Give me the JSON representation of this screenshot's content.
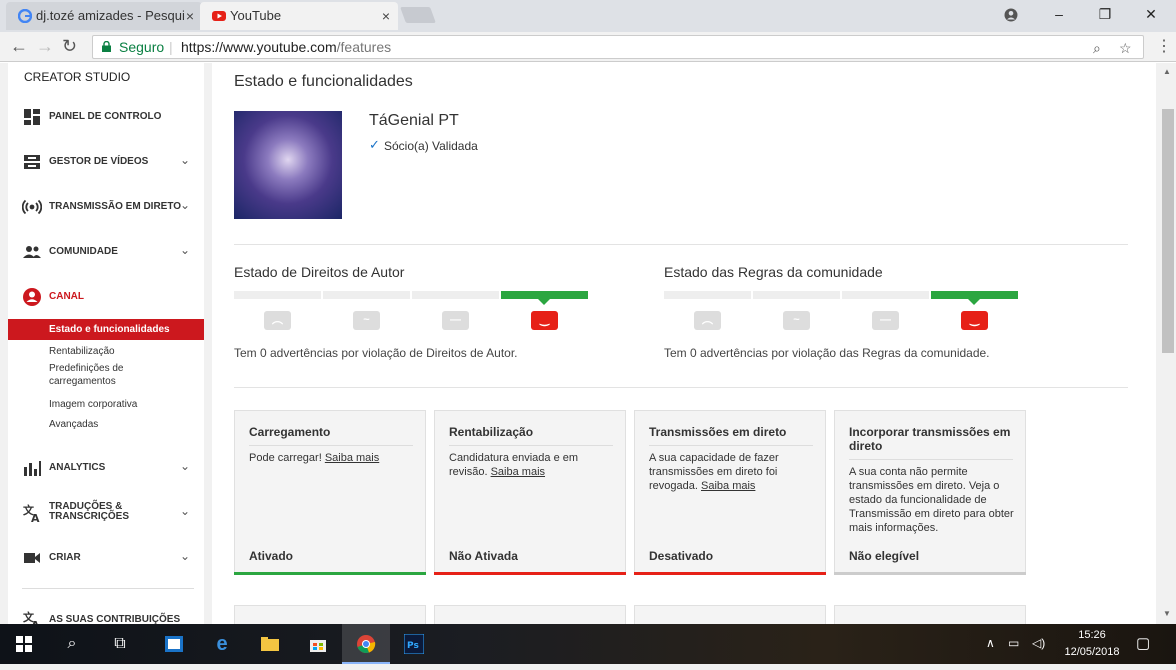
{
  "browser": {
    "tabs": [
      {
        "label": "dj.tozé amizades - Pesqui",
        "close": "×"
      },
      {
        "label": "YouTube",
        "close": "×"
      }
    ],
    "secure_label": "Seguro",
    "url_host": "https://www.youtube.com",
    "url_path": "/features",
    "window": {
      "min": "–",
      "max": "❐",
      "close": "✕"
    }
  },
  "sidebar": {
    "studio_title": "CREATOR STUDIO",
    "items": [
      {
        "label": "PAINEL DE CONTROLO",
        "icon": "dashboard-icon"
      },
      {
        "label": "GESTOR DE VÍDEOS",
        "icon": "video-manager-icon"
      },
      {
        "label": "TRANSMISSÃO EM DIRETO",
        "icon": "live-icon"
      },
      {
        "label": "COMUNIDADE",
        "icon": "community-icon"
      },
      {
        "label": "CANAL",
        "icon": "channel-icon"
      },
      {
        "label": "ANALYTICS",
        "icon": "analytics-icon"
      },
      {
        "label": "TRADUÇÕES & TRANSCRIÇÕES",
        "icon": "translate-icon"
      },
      {
        "label": "CRIAR",
        "icon": "create-icon"
      },
      {
        "label": "AS SUAS CONTRIBUIÇÕES",
        "icon": "contributions-icon"
      }
    ],
    "sub_items": [
      "Estado e funcionalidades",
      "Rentabilização",
      "Predefinições de carregamentos",
      "Imagem corporativa",
      "Avançadas"
    ],
    "accent": "#cc181e"
  },
  "main": {
    "title": "Estado e funcionalidades",
    "channel_name": "TáGenial PT",
    "partner_status": "Sócio(a) Validada",
    "copyright": {
      "heading": "Estado de Direitos de Autor",
      "strikes_text": "Tem 0 advertências por violação de Direitos de Autor.",
      "level": 4,
      "levels": 4
    },
    "community": {
      "heading": "Estado das Regras da comunidade",
      "strikes_text": "Tem 0 advertências por violação das Regras da comunidade.",
      "level": 4,
      "levels": 4
    },
    "cards": [
      {
        "title": "Carregamento",
        "body": "Pode carregar!",
        "link": "Saiba mais",
        "status": "Ativado",
        "bar_color": "#2ba640"
      },
      {
        "title": "Rentabilização",
        "body": "Candidatura enviada e em revisão.",
        "link": "Saiba mais",
        "status": "Não Ativada",
        "bar_color": "#e62117"
      },
      {
        "title": "Transmissões em direto",
        "body": "A sua capacidade de fazer transmissões em direto foi revogada.",
        "link": "Saiba mais",
        "status": "Desativado",
        "bar_color": "#e62117"
      },
      {
        "title": "Incorporar transmissões em direto",
        "body": "A sua conta não permite transmissões em direto. Veja o estado da funcionalidade de Transmissão em direto para obter mais informações.",
        "link": "",
        "status": "Não elegível",
        "bar_color": "#cccccc"
      }
    ]
  },
  "taskbar": {
    "time": "15:26",
    "date": "12/05/2018"
  }
}
